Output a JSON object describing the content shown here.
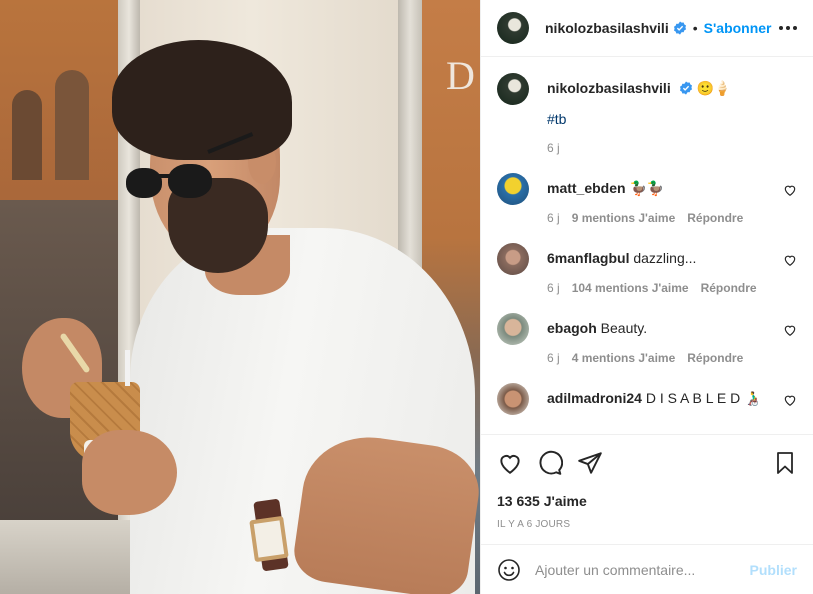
{
  "header": {
    "username": "nikolozbasilashvili",
    "separator": "•",
    "follow_label": "S'abonner"
  },
  "caption": {
    "username": "nikolozbasilashvili",
    "emojis": "🙂🍦",
    "hashtag": "#tb",
    "time": "6 j"
  },
  "comments": [
    {
      "username": "matt_ebden",
      "text": "🦆🦆",
      "time": "6 j",
      "likes": "9 mentions J'aime",
      "reply": "Répondre"
    },
    {
      "username": "6manflagbul",
      "text": "dazzling...",
      "time": "6 j",
      "likes": "104 mentions J'aime",
      "reply": "Répondre"
    },
    {
      "username": "ebagoh",
      "text": "Beauty.",
      "time": "6 j",
      "likes": "4 mentions J'aime",
      "reply": "Répondre"
    },
    {
      "username": "adilmadroni24",
      "text": "D I S A B L E D 👨‍🦽",
      "time": "",
      "likes": "",
      "reply": ""
    }
  ],
  "actions": {
    "likes_count": "13 635 J'aime",
    "posted_ago": "IL Y A 6 JOURS"
  },
  "add_comment": {
    "placeholder": "Ajouter un commentaire...",
    "publish_label": "Publier"
  },
  "colors": {
    "accent": "#0095f6",
    "verified": "#3897f0",
    "publish_disabled": "#b2dffc",
    "muted_text": "#8e8e8e"
  },
  "icons": [
    "verified-badge-icon",
    "more-options-icon",
    "heart-icon",
    "comment-icon",
    "share-icon",
    "bookmark-icon",
    "emoji-icon"
  ]
}
